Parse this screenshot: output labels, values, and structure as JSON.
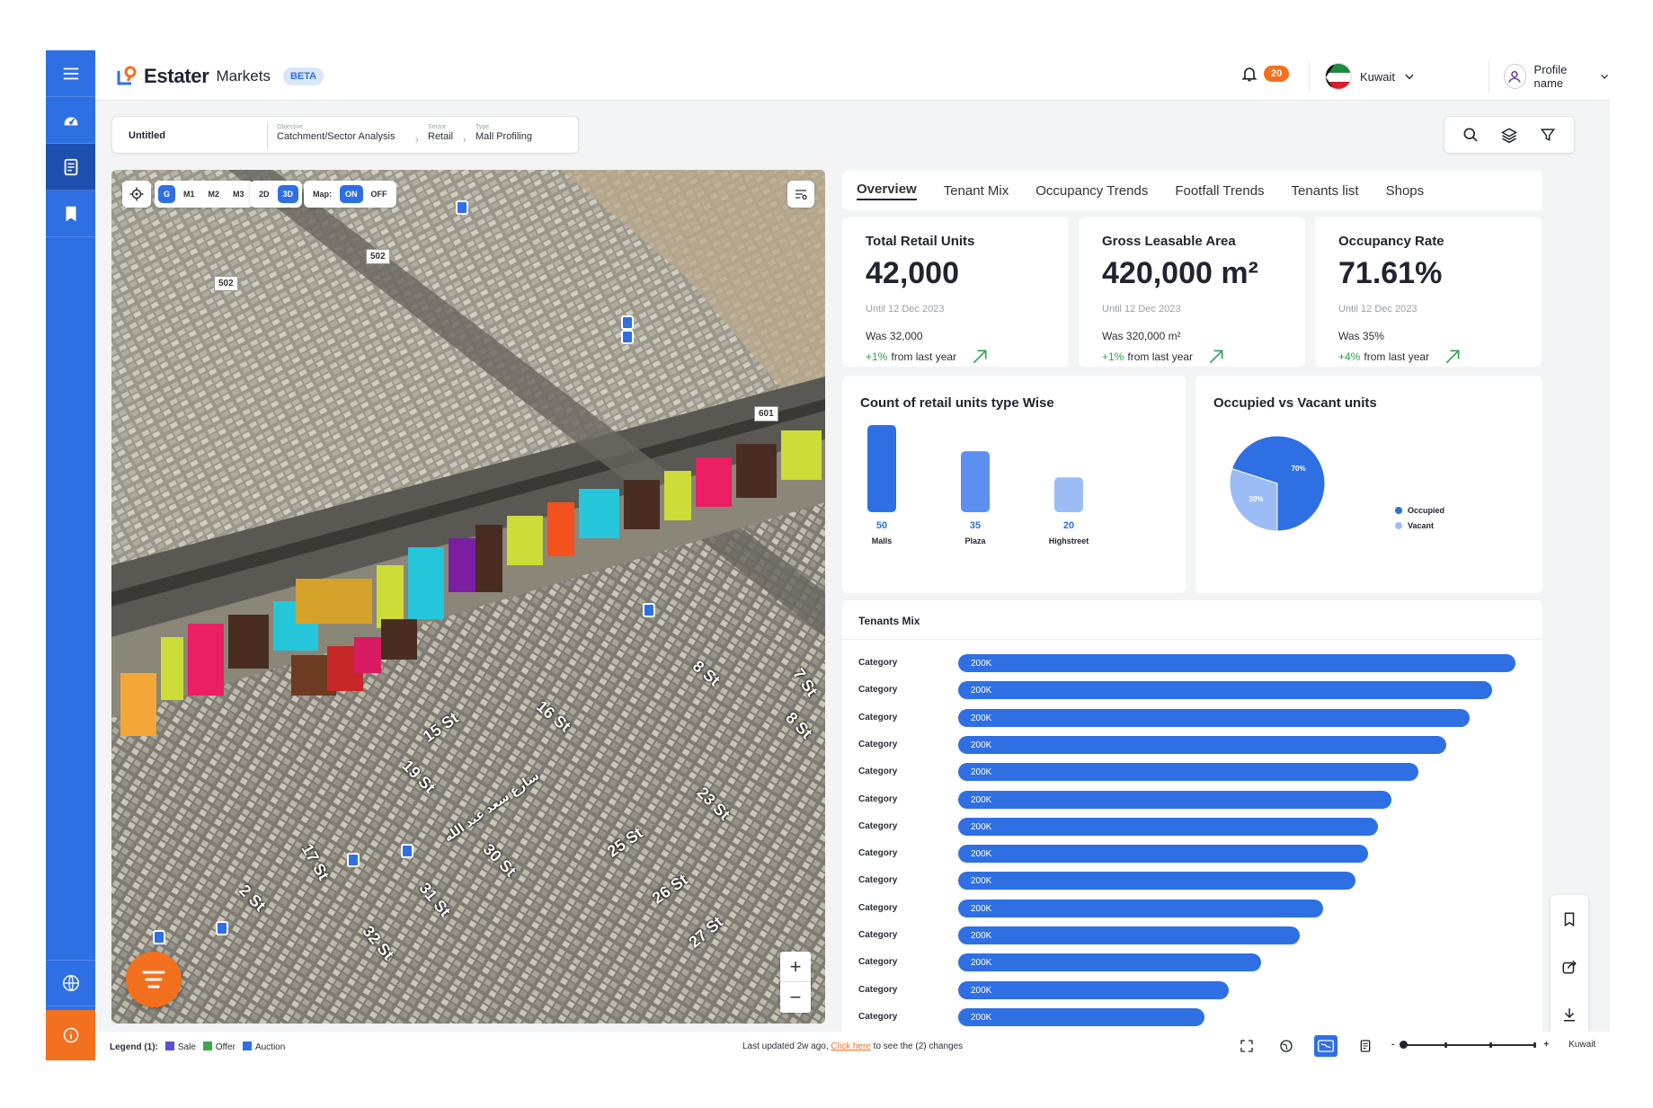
{
  "header": {
    "brand": "Estater",
    "product": "Markets",
    "badge": "BETA",
    "notifications": "20",
    "country": "Kuwait",
    "profile": "Profile name"
  },
  "breadcrumb": {
    "title": "Untitled",
    "fields": [
      {
        "key": "Objective",
        "value": "Catchment/Sector Analysis"
      },
      {
        "key": "Sector",
        "value": "Retail"
      },
      {
        "key": "Type",
        "value": "Mall Profiling"
      }
    ]
  },
  "map": {
    "layer_buttons": [
      "G",
      "M1",
      "M2",
      "M3"
    ],
    "active_layer": "G",
    "view_buttons": [
      "2D",
      "3D"
    ],
    "active_view": "3D",
    "map_toggle_label": "Map:",
    "map_toggle": [
      "ON",
      "OFF"
    ],
    "road_signs": [
      "502",
      "502",
      "601"
    ],
    "street_labels": [
      "8 St",
      "7 St",
      "8 St",
      "16 St",
      "15 St",
      "19 St",
      "23 St",
      "25 St",
      "26 St",
      "27 St",
      "30 St",
      "31 St",
      "32 St",
      "2 St",
      "17 St",
      "شارع سعد عبد الله"
    ],
    "zoom_in": "+",
    "zoom_out": "−"
  },
  "tabs": [
    "Overview",
    "Tenant Mix",
    "Occupancy Trends",
    "Footfall Trends",
    "Tenants list",
    "Shops"
  ],
  "active_tab": "Overview",
  "stats": [
    {
      "title": "Total Retail Units",
      "value": "42,000",
      "date": "Until 12 Dec 2023",
      "was": "Was 32,000",
      "change": "+1%",
      "suffix": "from last year"
    },
    {
      "title": "Gross Leasable Area",
      "value": "420,000 m²",
      "date": "Until 12 Dec 2023",
      "was": "Was 320,000 m²",
      "change": "+1%",
      "suffix": "from last year"
    },
    {
      "title": "Occupancy Rate",
      "value": "71.61%",
      "date": "Until 12 Dec 2023",
      "was": "Was 35%",
      "change": "+4%",
      "suffix": "from last year"
    }
  ],
  "chart_data": [
    {
      "type": "bar",
      "title": "Count of retail units type Wise",
      "categories": [
        "Malls",
        "Plaza",
        "Highstreet"
      ],
      "values": [
        50,
        35,
        20
      ],
      "colors": [
        "#2f6fe4",
        "#5c8ff0",
        "#9cbcf6"
      ]
    },
    {
      "type": "pie",
      "title": "Occupied vs Vacant units",
      "categories": [
        "Occupied",
        "Vacant"
      ],
      "values": [
        70,
        30
      ],
      "data_labels": [
        "70%",
        "30%"
      ],
      "colors": [
        "#2f6fe4",
        "#9cbcf6"
      ],
      "legend": "right"
    },
    {
      "type": "bar",
      "orientation": "horizontal",
      "title": "Tenants Mix",
      "categories": [
        "Category",
        "Category",
        "Category",
        "Category",
        "Category",
        "Category",
        "Category",
        "Category",
        "Category",
        "Category",
        "Category",
        "Category",
        "Category",
        "Category"
      ],
      "values": [
        1.0,
        0.958,
        0.917,
        0.876,
        0.826,
        0.777,
        0.753,
        0.736,
        0.713,
        0.655,
        0.613,
        0.544,
        0.485,
        0.442
      ],
      "data_labels": [
        "200K",
        "200K",
        "200K",
        "200K",
        "200K",
        "200K",
        "200K",
        "200K",
        "200K",
        "200K",
        "200K",
        "200K",
        "200K",
        "200K"
      ],
      "color": "#2f6fe4"
    }
  ],
  "footer": {
    "legend_label": "Legend (1):",
    "legend": [
      {
        "label": "Sale",
        "color": "#5b4fd6"
      },
      {
        "label": "Offer",
        "color": "#3ca84a"
      },
      {
        "label": "Auction",
        "color": "#2f6fe4"
      }
    ],
    "updated_prefix": "Last updated 2w ago,",
    "updated_link": "Click here",
    "updated_suffix": "to see the (2) changes",
    "slider_minus": "-",
    "slider_plus": "+",
    "region": "Kuwait"
  },
  "colors": {
    "primary": "#2f6fe4",
    "accent": "#f2701e",
    "positive": "#2ea44f"
  }
}
